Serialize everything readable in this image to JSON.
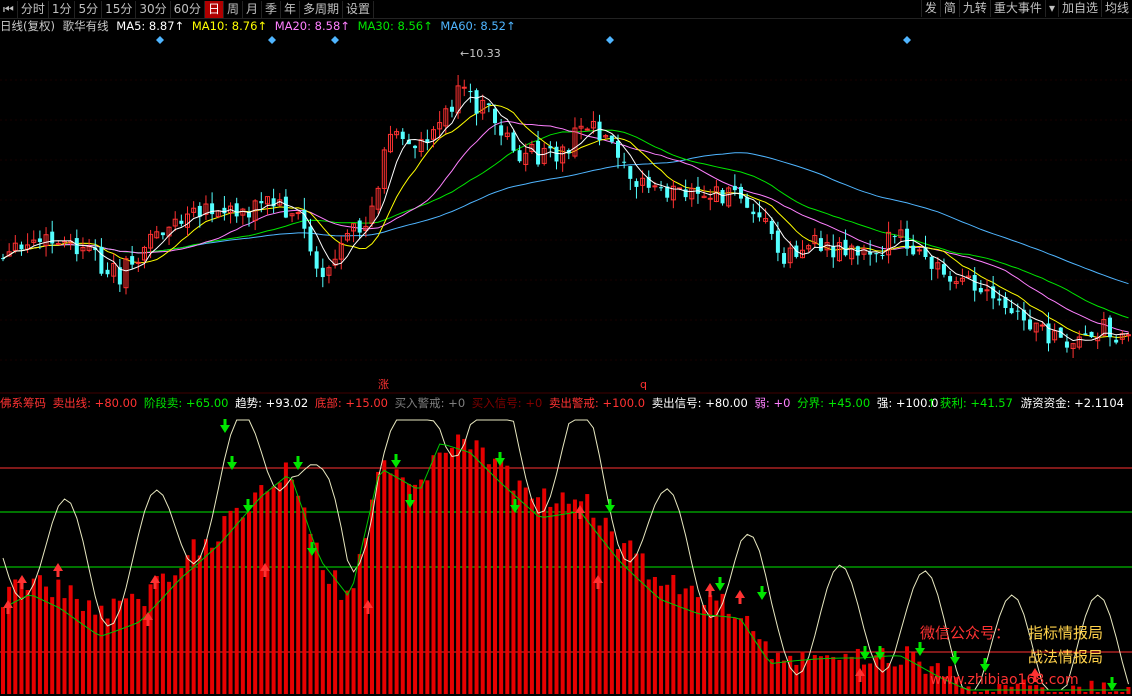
{
  "toolbar": {
    "back_icon": "skip-back-icon",
    "tabs": [
      "分时",
      "1分",
      "5分",
      "15分",
      "30分",
      "60分",
      "日",
      "周",
      "月",
      "季",
      "年",
      "多周期",
      "设置"
    ],
    "active_tab": "日",
    "right": [
      "发",
      "简",
      "九转",
      "重大事件",
      "加自选",
      "均线"
    ],
    "dropdown_icon": "triangle-down-icon"
  },
  "ma_row": {
    "period": "日线(复权)",
    "name": "歌华有线",
    "ma5": "MA5: 8.87↑",
    "ma10": "MA10: 8.76↑",
    "ma20": "MA20: 8.58↑",
    "ma30": "MA30: 8.56↑",
    "ma60": "MA60: 8.52↑"
  },
  "high_label": "←10.33",
  "markers": {
    "zhang": "涨",
    "q": "q"
  },
  "indicator": {
    "name": "佛系筹码",
    "sell_line": "卖出线: +80.00",
    "stage_sell": "阶段卖: +65.00",
    "trend": "趋势: +93.02",
    "bottom": "底部: +15.00",
    "buy_warn": "买入警戒: +0",
    "buy_signal": "买入信号: +0",
    "sell_warn": "卖出警戒: +100.0",
    "sell_signal": "卖出信号: +80.00",
    "weak": "弱: +0",
    "divide": "分界: +45.00",
    "strong": "强: +100.0",
    "profit": "↑ 获利: +41.57",
    "hot_money": "游资资金: +2.1104"
  },
  "watermark": {
    "wechat": "微信公众号：",
    "brand1": "指标情报局",
    "brand2": "战法情报局",
    "site": "www.zhibiao168.com"
  },
  "colors": {
    "up": "#ff3232",
    "down": "#54ffff",
    "ma5": "#ffffff",
    "ma10": "#ffff00",
    "ma20": "#ff80ff",
    "ma30": "#00e600",
    "ma60": "#4fb5ff",
    "bar": "#e60000",
    "buy_arrow": "#ff3232",
    "sell_arrow": "#00e600"
  }
}
